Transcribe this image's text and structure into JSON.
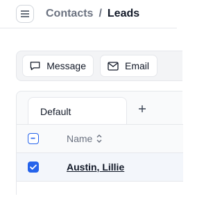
{
  "header": {
    "menu_icon": "hamburger-menu-icon",
    "breadcrumb": {
      "parent": "Contacts",
      "separator": "/",
      "current": "Leads"
    }
  },
  "toolbar": {
    "message_label": "Message",
    "message_icon": "chat-bubble-icon",
    "email_label": "Email",
    "email_icon": "envelope-icon"
  },
  "tabs": {
    "items": [
      {
        "label": "Default",
        "active": true
      }
    ],
    "add_icon": "plus-icon"
  },
  "table": {
    "columns": [
      {
        "label": "Name",
        "sort_icon": "sort-updown-icon"
      }
    ],
    "select_all_state": "indeterminate",
    "rows": [
      {
        "name": "Austin, Lillie",
        "selected": true
      }
    ]
  },
  "colors": {
    "accent": "#2563eb",
    "muted_text": "#6b7280",
    "border": "#e5e7eb"
  }
}
